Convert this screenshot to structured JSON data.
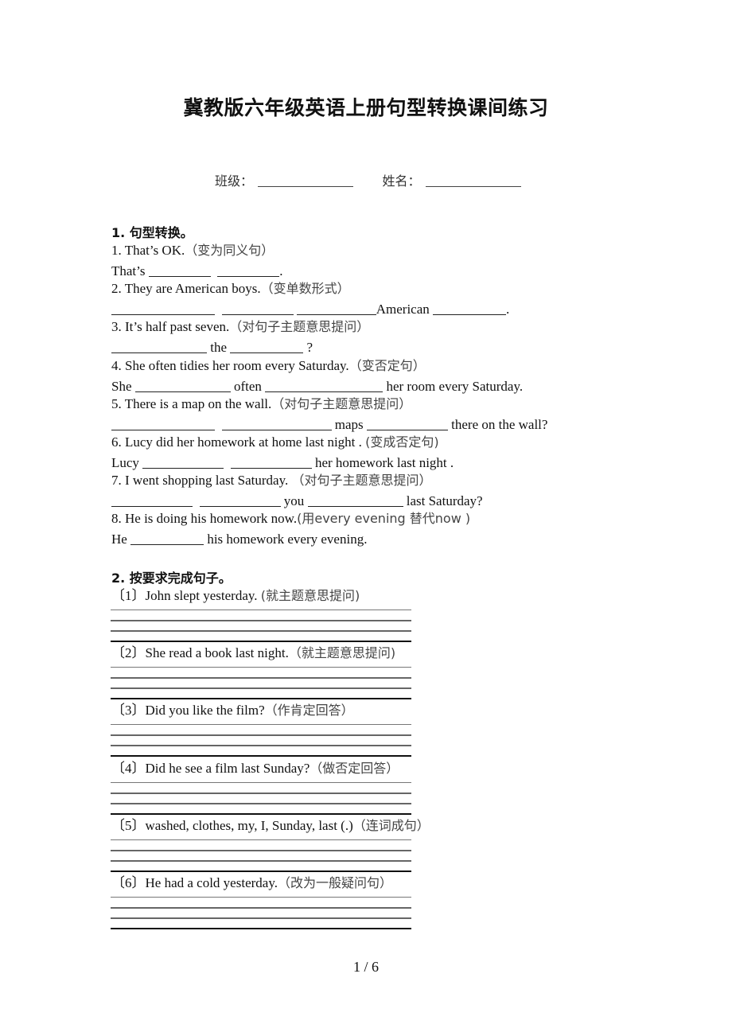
{
  "title": "冀教版六年级英语上册句型转换课间练习",
  "info": {
    "class_label": "班级：",
    "name_label": "姓名："
  },
  "section1": {
    "heading": "1.  句型转换。",
    "items": [
      {
        "prompt": "1. That’s OK.",
        "instruction": "（变为同义句）",
        "answer": [
          "That’s",
          ".",
          ""
        ]
      },
      {
        "prompt": "2. They are American boys.",
        "instruction": "（变单数形式）",
        "answer": [
          "American",
          "."
        ]
      },
      {
        "prompt": "3. It’s half past seven.",
        "instruction": "（对句子主题意思提问）",
        "answer": [
          "the",
          "?"
        ]
      },
      {
        "prompt": "4. She often tidies her room every Saturday.",
        "instruction": "（变否定句）",
        "answer": [
          "She",
          "often",
          "her room every Saturday."
        ]
      },
      {
        "prompt": "5. There is a map on the wall.",
        "instruction": "（对句子主题意思提问）",
        "answer": [
          "maps",
          "there on the wall?"
        ]
      },
      {
        "prompt": "6. Lucy did her homework at home last night . ",
        "instruction": "(变成否定句)",
        "answer": [
          "Lucy",
          "her homework last night ."
        ]
      },
      {
        "prompt": "7. I went shopping last Saturday. ",
        "instruction": "（对句子主题意思提问）",
        "answer": [
          "you",
          "last Saturday?"
        ]
      },
      {
        "prompt": "8. He is doing his homework now.",
        "instruction": "(用every evening 替代now )",
        "answer": [
          "He",
          "his homework every evening."
        ]
      }
    ]
  },
  "section2": {
    "heading": "2.  按要求完成句子。",
    "items": [
      {
        "num": "〔1〕",
        "prompt": "John slept yesterday. ",
        "instruction": "(就主题意思提问)"
      },
      {
        "num": "〔2〕",
        "prompt": "She read a book last night.",
        "instruction": "（就主题意思提问)"
      },
      {
        "num": "〔3〕",
        "prompt": "Did you like the film?",
        "instruction": "（作肯定回答）"
      },
      {
        "num": "〔4〕",
        "prompt": "Did he see a film last Sunday?",
        "instruction": "（做否定回答）"
      },
      {
        "num": "〔5〕",
        "prompt": "washed, clothes, my, I, Sunday, last (.)",
        "instruction": "（连词成句）"
      },
      {
        "num": "〔6〕",
        "prompt": "He had a cold yesterday.",
        "instruction": "（改为一般疑问句）"
      }
    ]
  },
  "footer": {
    "page": "1 / 6"
  }
}
